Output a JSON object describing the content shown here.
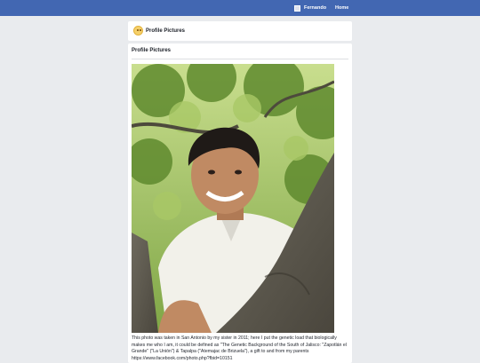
{
  "topbar": {
    "user_name": "Fernando",
    "home_label": "Home",
    "avatar_icon": "avatar-icon"
  },
  "header": {
    "title": "Profile Pictures",
    "icon": "emoji-icon"
  },
  "main": {
    "title": "Profile Pictures",
    "photo_description_icon": "profile-photo",
    "caption": "This photo was taken in San Antonio by my sister in 2011; here I put the genetic load that biologically makes me who I am, it could be defined as \"The Genetic Background of the South of Jalisco: \"Zapotlán el Grande\" (\"La Unión\") & Tapalpa (\"Atemajac de Brizuela\"), a gift to and from my parents https://www.facebook.com/photo.php?fbid=10151"
  },
  "colors": {
    "topbar": "#4267b2",
    "background": "#e9ebee",
    "card": "#ffffff"
  }
}
